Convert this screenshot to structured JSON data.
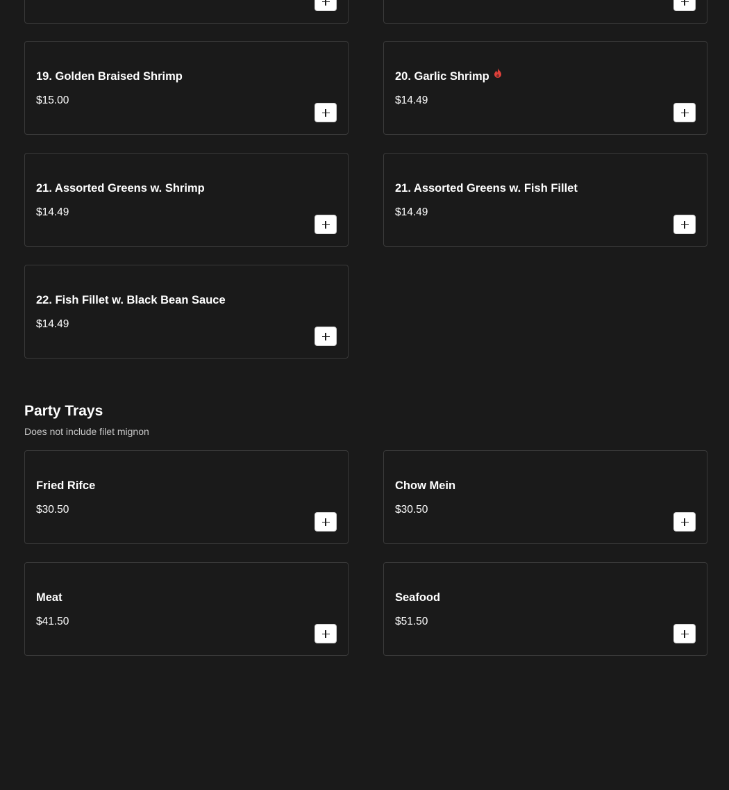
{
  "menu": {
    "top_items": [
      {
        "name": "19. Golden Braised Shrimp",
        "price": "$15.00",
        "add_label": "Add item"
      },
      {
        "name": "20. Garlic Shrimp",
        "price": "$14.49",
        "spicy": true,
        "spicy_icon": "chili-icon",
        "spicy_color": "#e0403a"
      },
      {
        "name": "21. Assorted Greens w. Shrimp",
        "price": "$14.49"
      },
      {
        "name": "21. Assorted Greens w. Fish Fillet",
        "price": "$14.49"
      },
      {
        "name": "22. Fish Fillet w. Black Bean Sauce",
        "price": "$14.49"
      }
    ],
    "party_trays": {
      "title": "Party Trays",
      "subtitle": "Does not include filet mignon",
      "items": [
        {
          "name": "Fried Rifce",
          "price": "$30.50"
        },
        {
          "name": "Chow Mein",
          "price": "$30.50"
        },
        {
          "name": "Meat",
          "price": "$41.50"
        },
        {
          "name": "Seafood",
          "price": "$51.50"
        }
      ]
    },
    "add_icon": "plus-icon",
    "colors": {
      "background": "#1a1a1a",
      "card_border": "#3a3a3a",
      "button_bg": "#ffffff",
      "text": "#ffffff",
      "subtext": "#c8c8c8"
    }
  }
}
